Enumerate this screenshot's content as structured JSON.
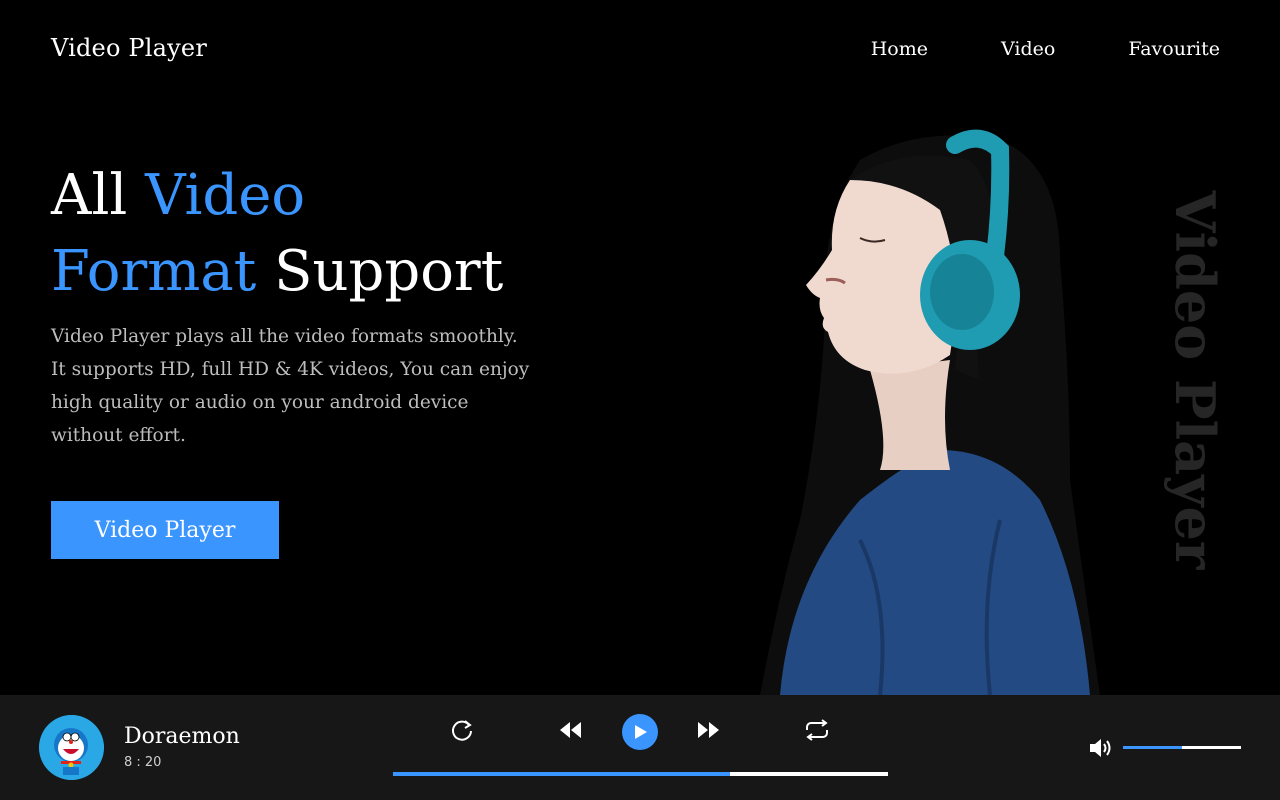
{
  "header": {
    "brand": "Video Player",
    "nav": [
      {
        "label": "Home"
      },
      {
        "label": "Video"
      },
      {
        "label": "Favourite"
      }
    ]
  },
  "hero": {
    "headline_line1_plain": "All ",
    "headline_line1_accent": "Video",
    "headline_line2_accent": "Format",
    "headline_line2_plain": " Support",
    "description": "Video Player plays all the video formats smoothly. It supports HD, full HD & 4K videos, You can enjoy high quality or audio on your android device without effort.",
    "cta_label": "Video Player",
    "vertical_title": "Video Player",
    "image_icon": "woman-with-headphones-image"
  },
  "player": {
    "track_title": "Doraemon",
    "track_time": "8 : 20",
    "thumbnail_icon": "doraemon-avatar",
    "controls": [
      "replay-icon",
      "rewind-icon",
      "play-icon",
      "fast-forward-icon",
      "repeat-icon"
    ],
    "progress_fraction": 0.68,
    "volume_fraction": 0.5,
    "volume_icon": "volume-icon"
  },
  "colors": {
    "accent": "#3b95ff",
    "background": "#000000",
    "player_bar": "#171717",
    "muted_text": "#bdbdbd"
  }
}
